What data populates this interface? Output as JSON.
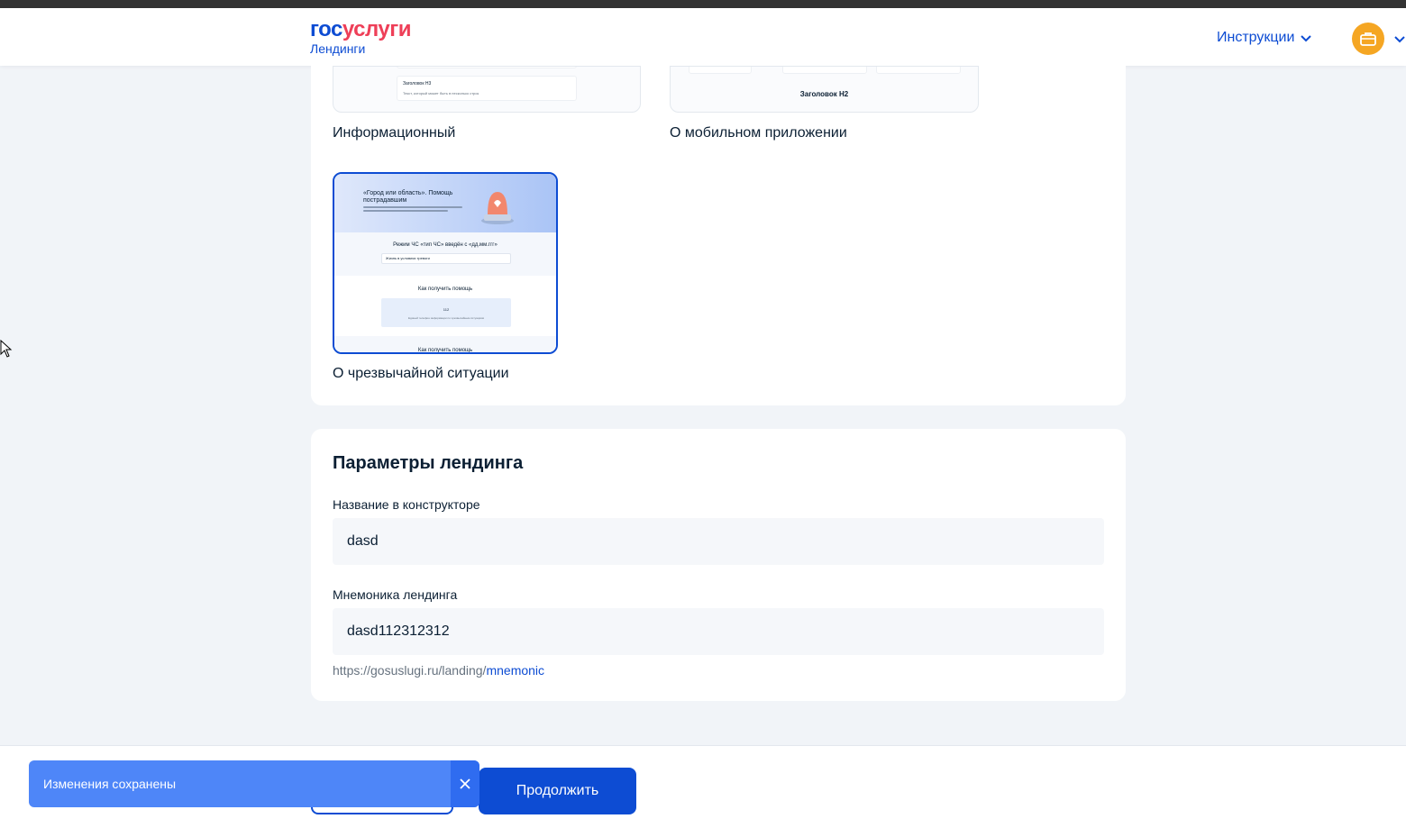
{
  "header": {
    "logo_gos": "гос",
    "logo_uslugi": "услуги",
    "logo_sub": "Лендинги",
    "instructions_label": "Инструкции"
  },
  "templates": {
    "info_label": "Информационный",
    "mobile_label": "О мобильном приложении",
    "mobile_heading": "Заголовок H2",
    "info_heading": "Заголовок H3",
    "info_text": "Текст, который может быть в несколько строк",
    "emergency_label": "О чрезвычайной ситуации",
    "emergency_preview": {
      "title": "«Город или область». Помощь пострадавшим",
      "mode_heading": "Режим ЧС «тип ЧС» введён с «дд.мм.ггг»",
      "field_text": "Жизнь в условиях тревоги",
      "help_heading": "Как получить помощь",
      "phone": "112",
      "help_text": "Единый телефон информации по чрезвычайным ситуациям",
      "footer_heading": "Как получить помощь"
    }
  },
  "params": {
    "title": "Параметры лендинга",
    "name_label": "Название в конструкторе",
    "name_value": "dasd",
    "mnemonic_label": "Мнемоника лендинга",
    "mnemonic_value": "dasd112312312",
    "url_prefix": "https://gosuslugi.ru/landing/",
    "url_mnemonic": "mnemonic"
  },
  "footer": {
    "continue_label": "Продолжить"
  },
  "toast": {
    "message": "Изменения сохранены"
  },
  "colors": {
    "brand_blue": "#0d4cd3",
    "brand_red": "#ee3f58",
    "toast_bg": "#4e86f8",
    "avatar_bg": "#f5a623"
  }
}
